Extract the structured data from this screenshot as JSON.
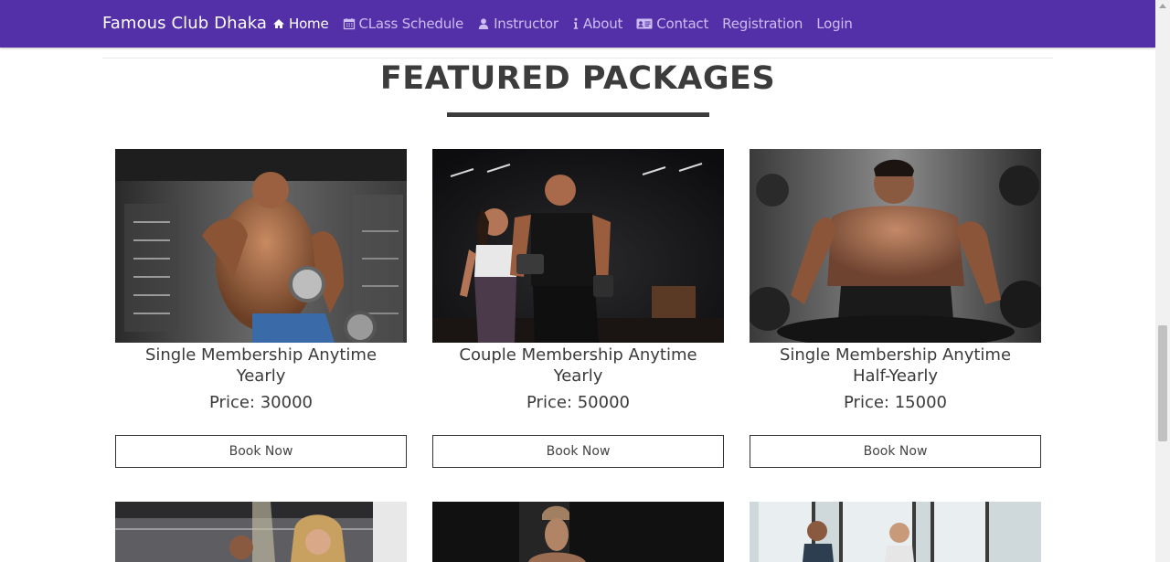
{
  "navbar": {
    "brand": "Famous Club Dhaka",
    "items": [
      {
        "label": "Home",
        "icon": "home-icon",
        "active": true
      },
      {
        "label": "CLass Schedule",
        "icon": "calendar-icon",
        "active": false
      },
      {
        "label": "Instructor",
        "icon": "user-icon",
        "active": false
      },
      {
        "label": "About",
        "icon": "info-icon",
        "active": false
      },
      {
        "label": "Contact",
        "icon": "id-card-icon",
        "active": false
      },
      {
        "label": "Registration",
        "icon": "",
        "active": false
      },
      {
        "label": "Login",
        "icon": "",
        "active": false
      }
    ],
    "colors": {
      "background": "#5330a7",
      "active": "#ffffff",
      "inactive": "#cdbcf2"
    }
  },
  "section": {
    "title": "FEATURED PACKAGES"
  },
  "packages": [
    {
      "name": "Single Membership Anytime Yearly",
      "price": "Price: 30000",
      "button": "Book Now",
      "image": "bodybuilder-dumbbell-photo"
    },
    {
      "name": "Couple Membership Anytime Yearly",
      "price": "Price: 50000",
      "button": "Book Now",
      "image": "couple-gym-photo"
    },
    {
      "name": "Single Membership Anytime Half-Yearly",
      "price": "Price: 15000",
      "button": "Book Now",
      "image": "bodybuilder-portrait-photo"
    }
  ],
  "second_row_images": [
    "gym-couple-photo",
    "male-fitness-photo",
    "group-exercise-photo"
  ]
}
